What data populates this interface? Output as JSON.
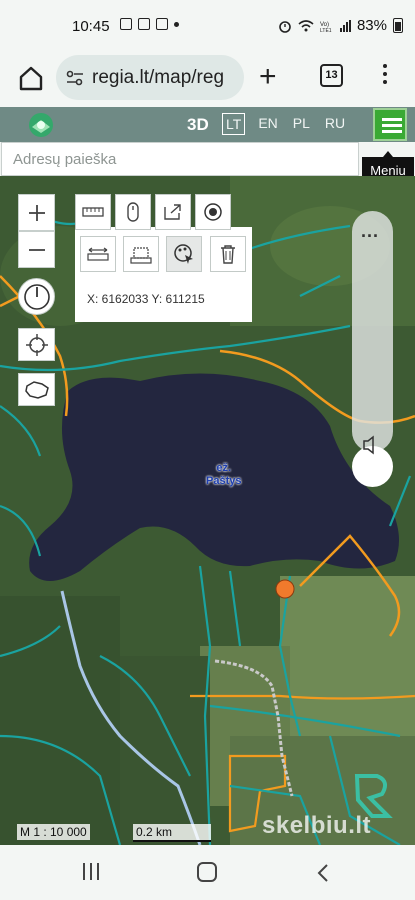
{
  "status_bar": {
    "time": "10:45",
    "battery": "83%",
    "left_icons": [
      "photo-icon",
      "check-icon",
      "calendar-icon",
      "notification-dot-icon"
    ],
    "right_icons": [
      "alarm-icon",
      "wifi-icon",
      "volte-icon",
      "signal-icon",
      "battery-icon"
    ]
  },
  "browser": {
    "url": "regia.lt/map/reg",
    "tab_count": "13"
  },
  "map_header": {
    "btn_3d": "3D",
    "languages": [
      "LT",
      "EN",
      "PL",
      "RU"
    ],
    "active_language": "LT",
    "menu_tooltip": "Meniu"
  },
  "search": {
    "placeholder": "Adresų paieška"
  },
  "map": {
    "coordinates": "X: 6162033 Y: 611215",
    "lake_label_line1": "ež.",
    "lake_label_line2": "Paštys",
    "scale_text": "M 1 : 10 000",
    "distance_text": "0.2 km",
    "watermark": "skelbiu.lt",
    "colors": {
      "accent_green": "#3aa934",
      "parcel_teal": "#1aa3a0",
      "road_orange": "#f29b1f",
      "lake": "#23263f",
      "marker": "#f07a2c"
    }
  }
}
